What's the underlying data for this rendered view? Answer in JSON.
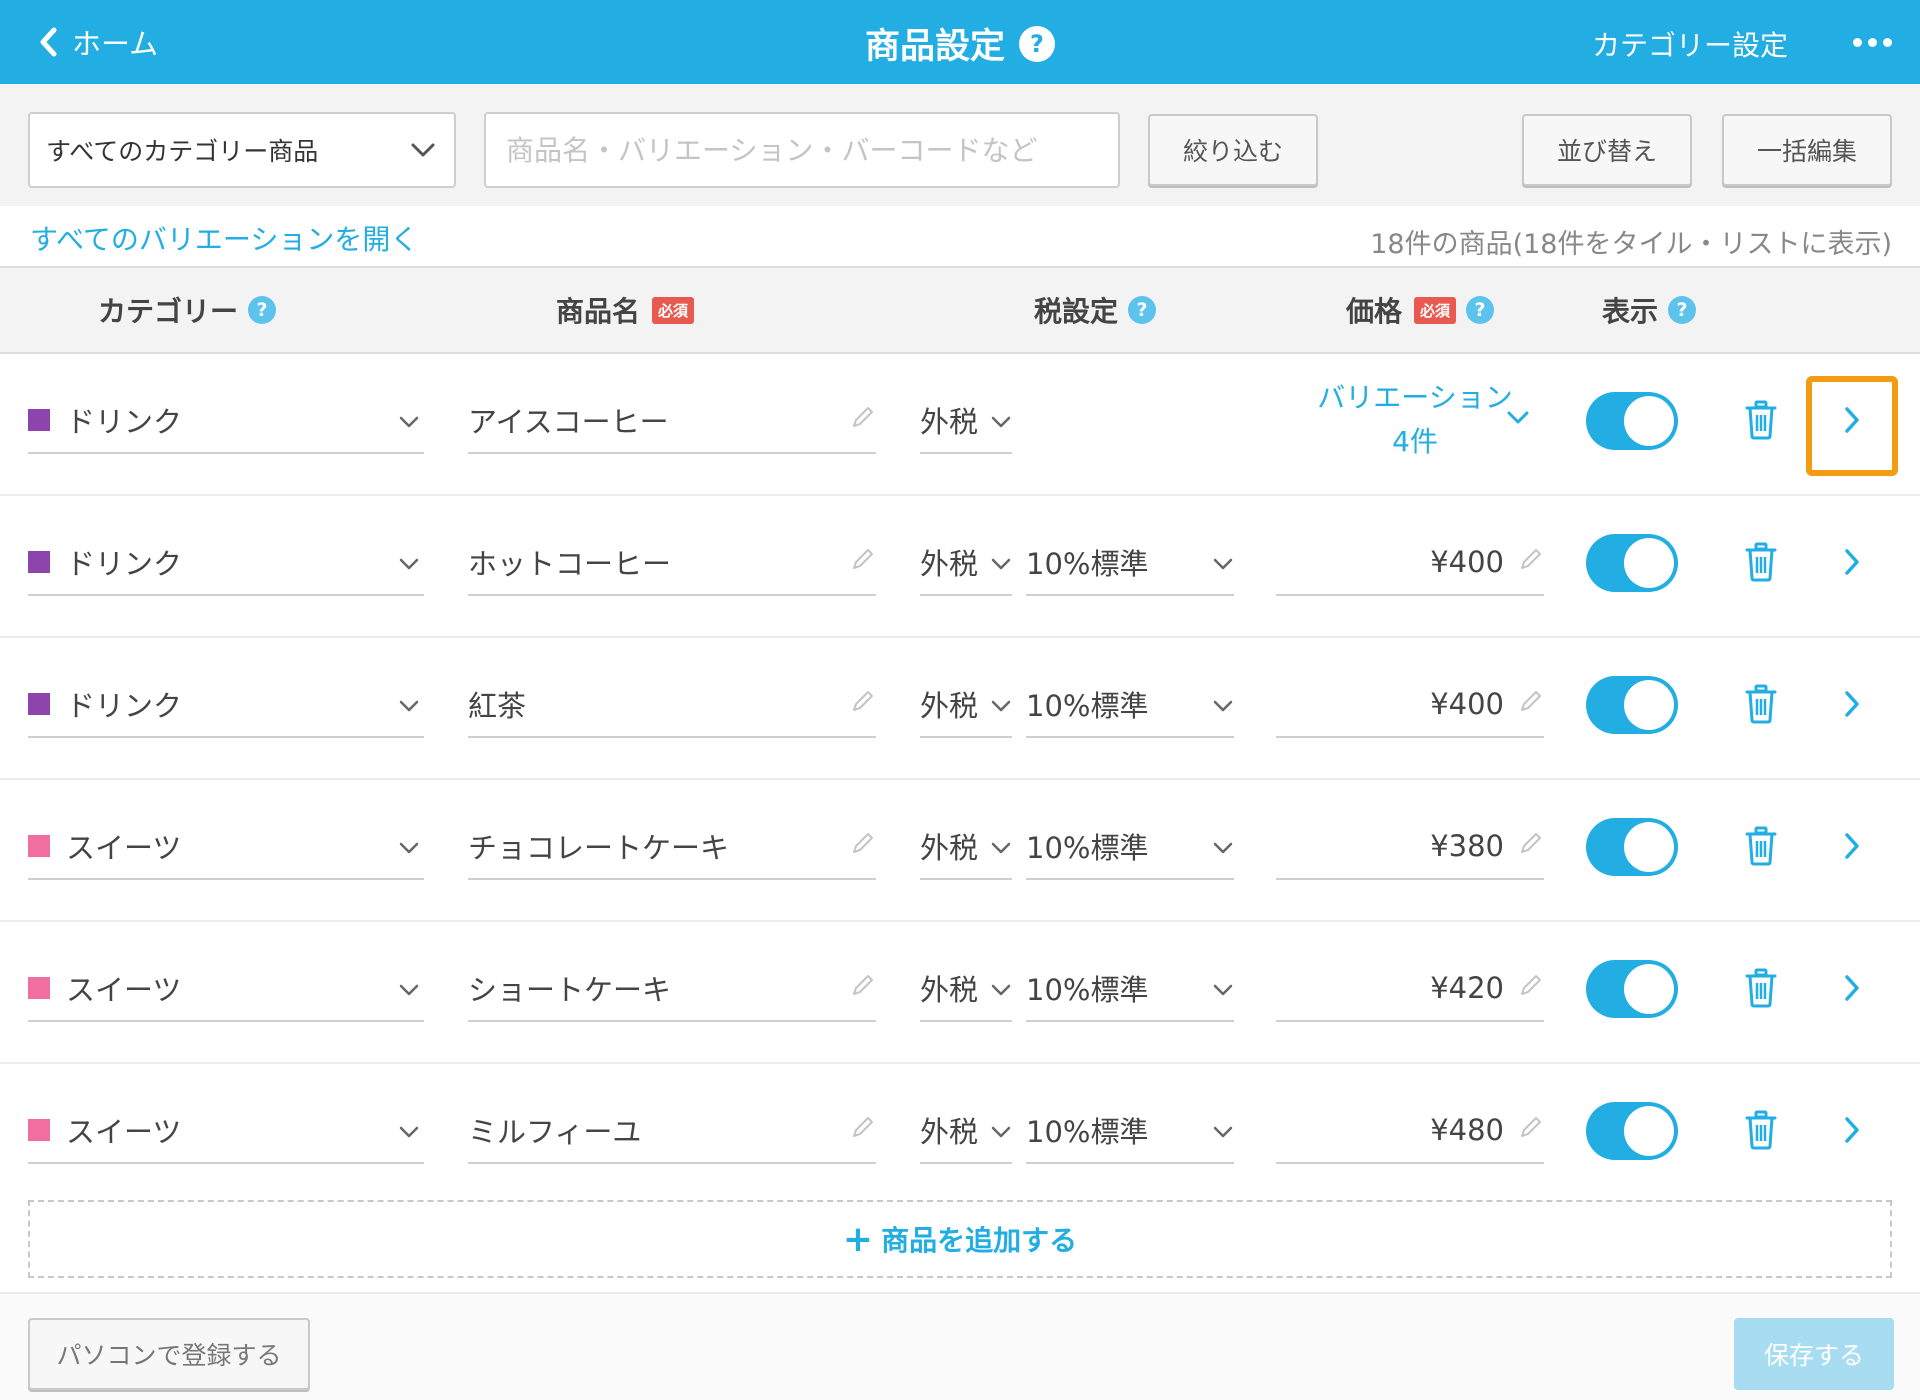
{
  "header": {
    "back_label": "ホーム",
    "title": "商品設定",
    "help": "?",
    "category_setting": "カテゴリー設定",
    "bg_color": "#22ade3"
  },
  "toolbar": {
    "category_select": "すべてのカテゴリー商品",
    "search_placeholder": "商品名・バリエーション・バーコードなど",
    "search_value": "",
    "filter_label": "絞り込む",
    "sort_label": "並び替え",
    "bulk_edit_label": "一括編集"
  },
  "info": {
    "open_all_variations": "すべてのバリエーションを開く",
    "count_text": "18件の商品(18件をタイル・リストに表示)"
  },
  "columns": {
    "category": "カテゴリー",
    "name": "商品名",
    "required": "必須",
    "tax": "税設定",
    "price": "価格",
    "visible": "表示",
    "help": "?"
  },
  "rows": [
    {
      "category": "ドリンク",
      "category_color": "#8e44ad",
      "name": "アイスコーヒー",
      "tax": "外税",
      "rate": "",
      "price": "",
      "variation": "バリエーション",
      "variation_count": "4件",
      "visible": true
    },
    {
      "category": "ドリンク",
      "category_color": "#8e44ad",
      "name": "ホットコーヒー",
      "tax": "外税",
      "rate": "10%標準",
      "price": "¥400",
      "visible": true
    },
    {
      "category": "ドリンク",
      "category_color": "#8e44ad",
      "name": "紅茶",
      "tax": "外税",
      "rate": "10%標準",
      "price": "¥400",
      "visible": true
    },
    {
      "category": "スイーツ",
      "category_color": "#f06fa0",
      "name": "チョコレートケーキ",
      "tax": "外税",
      "rate": "10%標準",
      "price": "¥380",
      "visible": true
    },
    {
      "category": "スイーツ",
      "category_color": "#f06fa0",
      "name": "ショートケーキ",
      "tax": "外税",
      "rate": "10%標準",
      "price": "¥420",
      "visible": true
    },
    {
      "category": "スイーツ",
      "category_color": "#f06fa0",
      "name": "ミルフィーユ",
      "tax": "外税",
      "rate": "10%標準",
      "price": "¥480",
      "visible": true
    }
  ],
  "add_product": "商品を追加する",
  "footer": {
    "register_pc": "パソコンで登録する",
    "save": "保存する"
  },
  "colors": {
    "accent": "#22ade3",
    "highlight": "#f39c12",
    "required_badge": "#e8594f"
  }
}
